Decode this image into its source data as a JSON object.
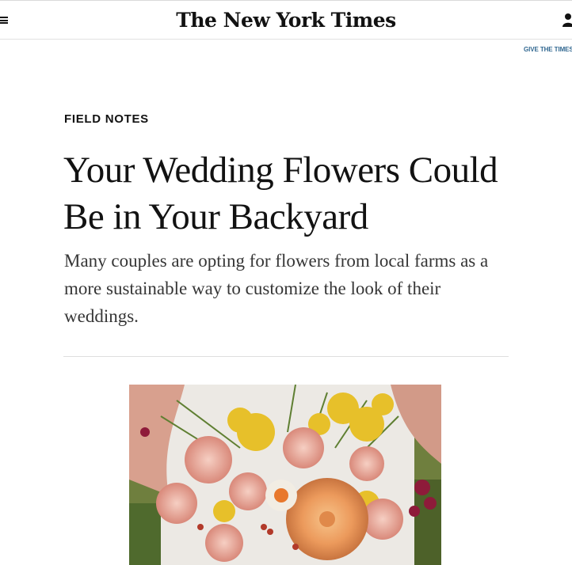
{
  "header": {
    "masthead": "The New York Times",
    "menu_icon": "hamburger-menu-icon",
    "account_icon": "account-icon",
    "give_link": "GIVE THE TIMES"
  },
  "article": {
    "kicker": "FIELD NOTES",
    "headline": "Your Wedding Flowers Could Be in Your Backyard",
    "summary": "Many couples are opting for flowers from local farms as a more sustainable way to customize the look of their weddings."
  },
  "photo": {
    "subject": "wedding-bouquet-image"
  },
  "colors": {
    "text": "#121212",
    "summary": "#363636",
    "link": "#326891",
    "rule": "#dfdfdf"
  }
}
